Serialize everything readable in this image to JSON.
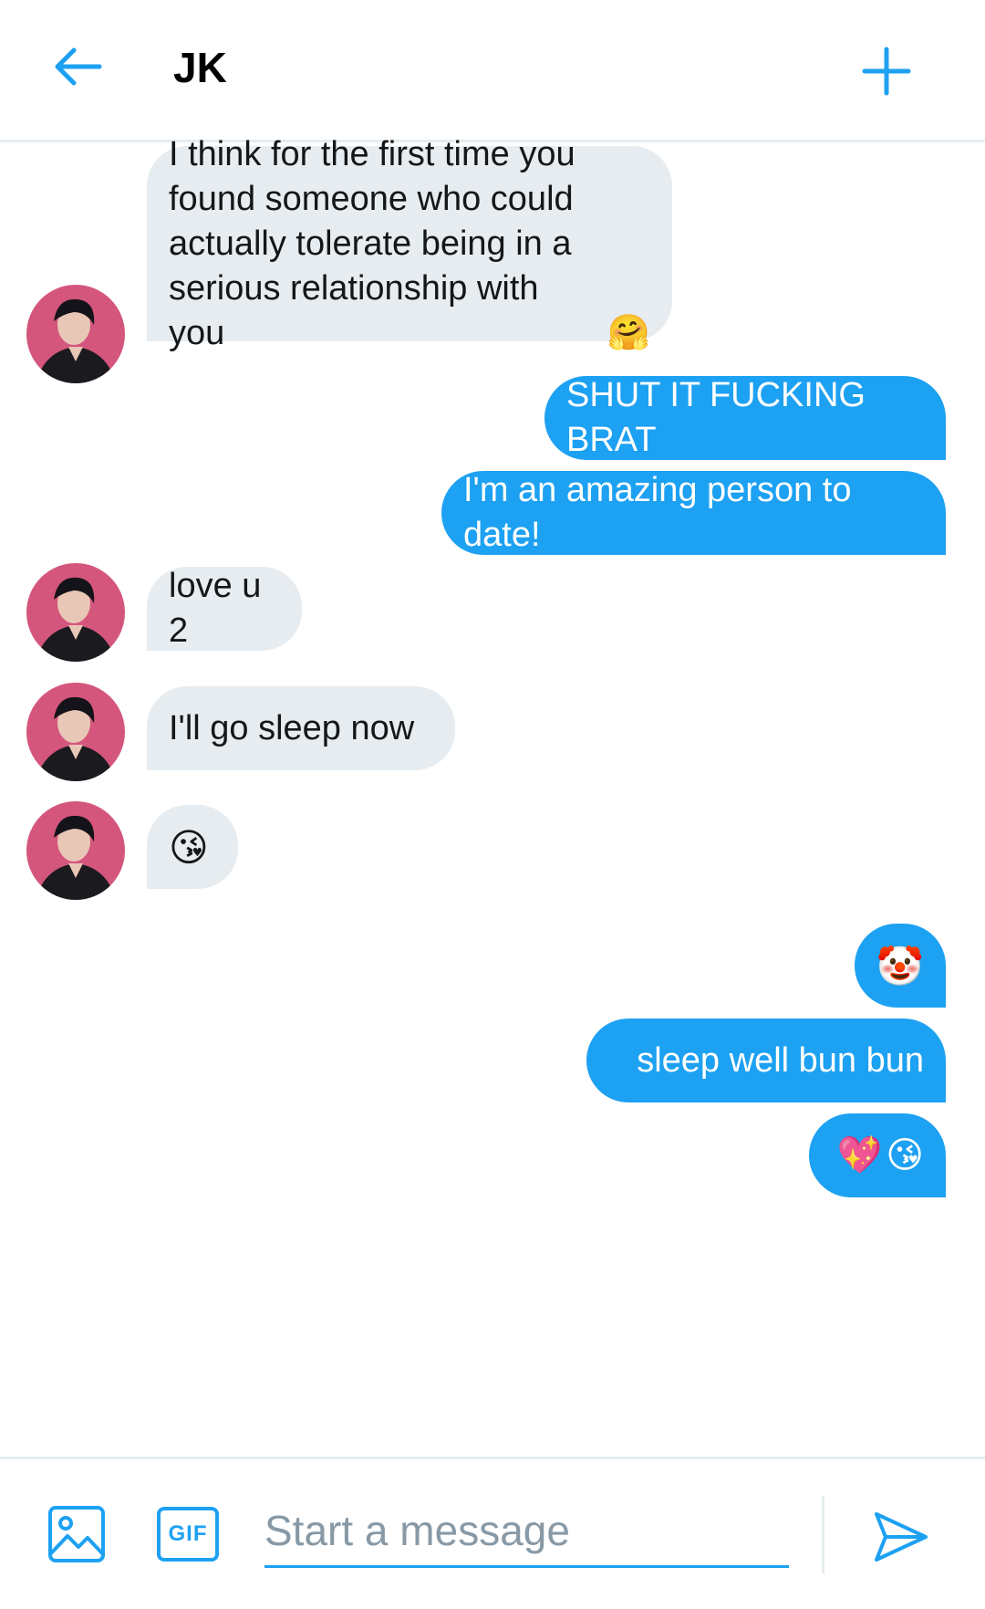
{
  "header": {
    "title": "JK"
  },
  "messages": [
    {
      "direction": "in",
      "text": "I think for the first time you\nfound someone who could\nactually tolerate being in a\nserious relationship with you",
      "emoji": [
        "🤗"
      ]
    },
    {
      "direction": "out",
      "text": "SHUT IT FUCKING BRAT"
    },
    {
      "direction": "out",
      "text": "I'm an amazing person to date!"
    },
    {
      "direction": "in",
      "text": "love u 2"
    },
    {
      "direction": "in",
      "text": "I'll go sleep now"
    },
    {
      "direction": "in",
      "text": "",
      "emoji": [
        "😘"
      ]
    },
    {
      "direction": "out",
      "text": "",
      "emoji": [
        "🤡"
      ]
    },
    {
      "direction": "out",
      "text": "sleep well bun bun"
    },
    {
      "direction": "out",
      "text": "",
      "emoji": [
        "💖",
        "😘"
      ]
    }
  ],
  "composer": {
    "placeholder": "Start a message",
    "gif_label": "GIF"
  },
  "icons": {
    "back": "arrow-left-icon",
    "add": "plus-icon",
    "media": "image-icon",
    "gif": "gif-icon",
    "send": "send-icon"
  },
  "colors": {
    "accent": "#1da1f2",
    "incoming_bubble": "#e6ecf0",
    "text": "#14171a",
    "placeholder": "#8899a6",
    "divider": "#e6ecf0"
  }
}
